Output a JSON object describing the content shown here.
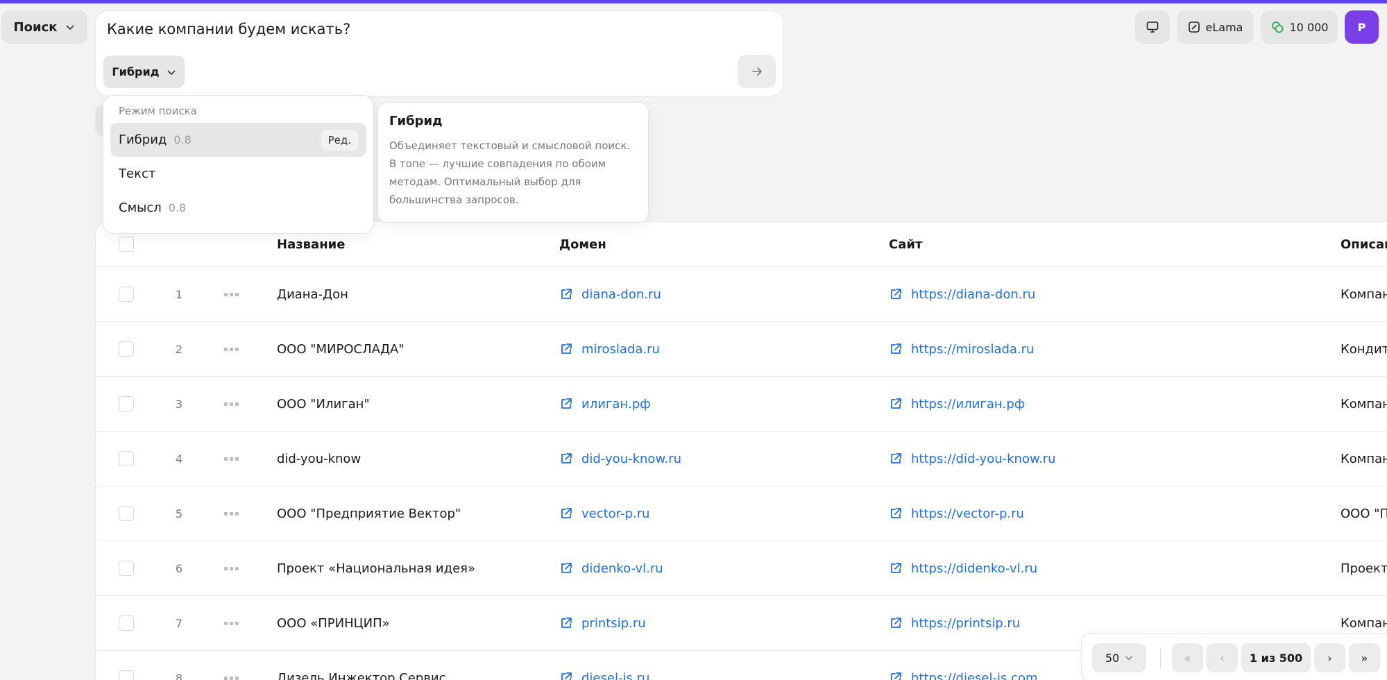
{
  "colors": {
    "accent": "#5b45f0",
    "link": "#1f6fe5",
    "avatar": "#7a3fe6",
    "coins": "#2fa84f"
  },
  "mode_button": {
    "label": "Поиск"
  },
  "search": {
    "placeholder": "Какие компании будем искать?",
    "mode_chip": "Гибрид"
  },
  "topbar": {
    "elama_label": "eLama",
    "balance": "10 000",
    "avatar_letter": "P"
  },
  "search_mode_menu": {
    "heading": "Режим поиска",
    "items": [
      {
        "label": "Гибрид",
        "value": "0.8",
        "edit": "Ред.",
        "active": true
      },
      {
        "label": "Текст",
        "value": ""
      },
      {
        "label": "Смысл",
        "value": "0.8"
      }
    ]
  },
  "tooltip": {
    "title": "Гибрид",
    "body": "Объединяет текстовый и смысловой поиск. В топе — лучшие совпадения по обоим методам. Оптимальный выбор для большинства запросов."
  },
  "table": {
    "columns": {
      "name": "Название",
      "domain": "Домен",
      "site": "Сайт",
      "description": "Описан"
    },
    "rows": [
      {
        "n": "1",
        "name": "Диана-Дон",
        "domain": "diana-don.ru",
        "site": "https://diana-don.ru",
        "desc": "Компан"
      },
      {
        "n": "2",
        "name": "ООО \"МИРОСЛАДА\"",
        "domain": "miroslada.ru",
        "site": "https://miroslada.ru",
        "desc": "Кондит"
      },
      {
        "n": "3",
        "name": "ООО \"Илиган\"",
        "domain": "илиган.рф",
        "site": "https://илиган.рф",
        "desc": "Компан"
      },
      {
        "n": "4",
        "name": "did-you-know",
        "domain": "did-you-know.ru",
        "site": "https://did-you-know.ru",
        "desc": "Компан"
      },
      {
        "n": "5",
        "name": "ООО \"Предприятие Вектор\"",
        "domain": "vector-p.ru",
        "site": "https://vector-p.ru",
        "desc": "ООО \"П"
      },
      {
        "n": "6",
        "name": "Проект «Национальная идея»",
        "domain": "didenko-vl.ru",
        "site": "https://didenko-vl.ru",
        "desc": "Проект"
      },
      {
        "n": "7",
        "name": "ООО «ПРИНЦИП»",
        "domain": "printsip.ru",
        "site": "https://printsip.ru",
        "desc": "Компан"
      },
      {
        "n": "8",
        "name": "Дизель Инжектор Сервис",
        "domain": "diesel-is.ru",
        "site": "https://diesel-is.com",
        "desc": ""
      }
    ]
  },
  "pagination": {
    "page_size": "50",
    "page_info": "1 из 500",
    "first": "«",
    "prev": "‹",
    "next": "›",
    "last": "»"
  }
}
